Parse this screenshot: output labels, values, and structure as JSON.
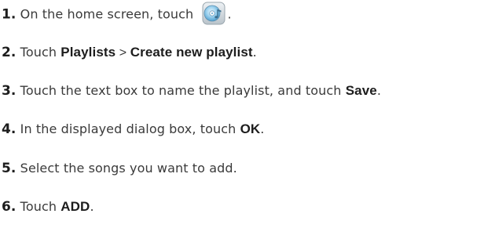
{
  "steps": [
    {
      "number": "1.",
      "text_before": " On the home screen, touch",
      "icon": "music-player-icon",
      "text_after": "."
    },
    {
      "number": "2.",
      "text_before": " Touch ",
      "bold_1": "Playlists",
      "separator": " > ",
      "bold_2": "Create new playlist",
      "text_after": "."
    },
    {
      "number": "3.",
      "text_before": " Touch the text box to name the playlist, and touch ",
      "bold_1": "Save",
      "text_after": "."
    },
    {
      "number": "4.",
      "text_before": " In the displayed dialog box, touch ",
      "bold_1": "OK",
      "text_after": "."
    },
    {
      "number": "5.",
      "text_before": " Select the songs you want to add."
    },
    {
      "number": "6.",
      "text_before": " Touch ",
      "bold_1": "ADD",
      "text_after": "."
    }
  ],
  "colors": {
    "text": "#3a3a3a",
    "bold": "#1d1d1d",
    "icon_disc": "#7ec4e6",
    "icon_frame": "#c9d2d8"
  }
}
